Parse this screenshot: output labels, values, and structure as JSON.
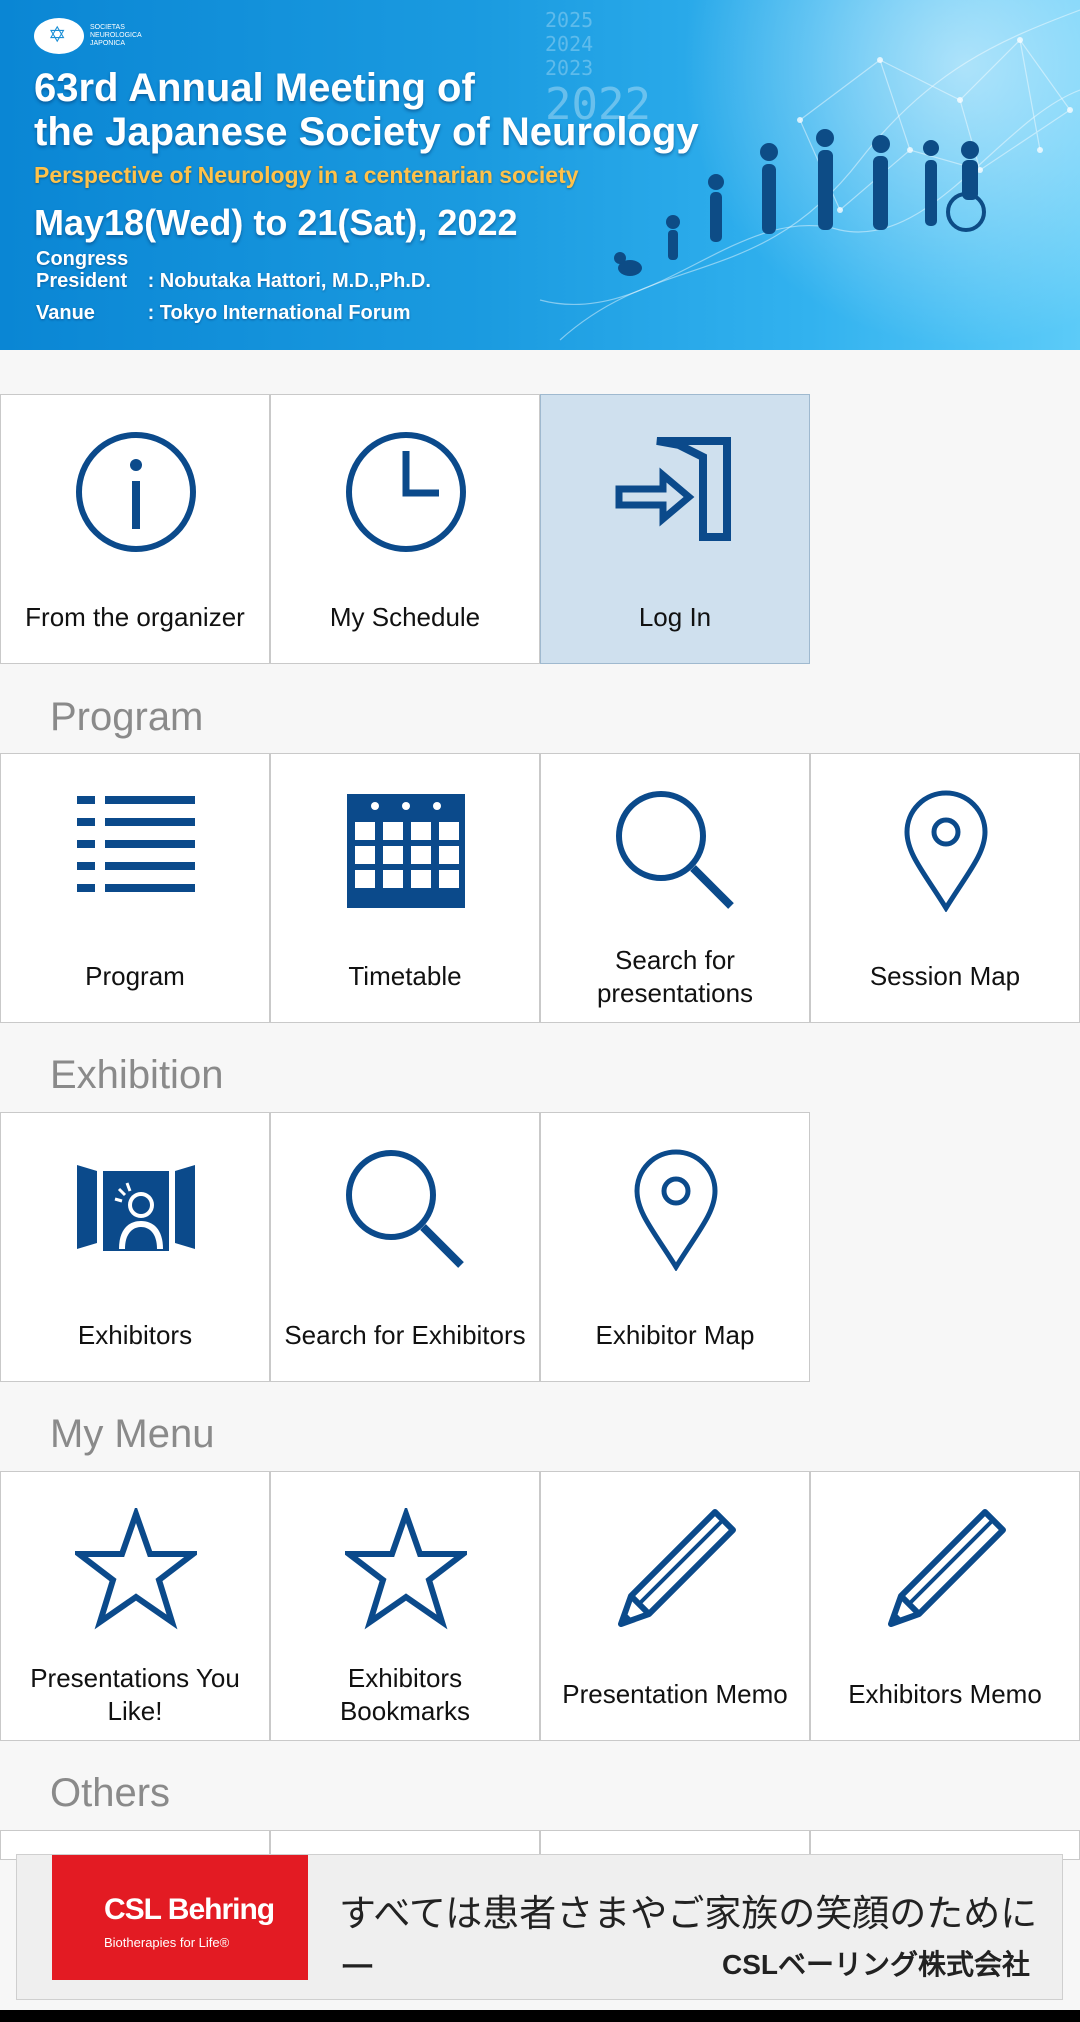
{
  "banner": {
    "logo_text": "SOCIETAS NEUROLOGICA JAPONICA",
    "years": [
      "2025",
      "2024",
      "2023",
      "2022"
    ],
    "title_line1": "63rd Annual Meeting of",
    "title_line2": "the Japanese Society of Neurology",
    "subtitle": "Perspective of Neurology in a centenarian society",
    "dates": "May18(Wed) to 21(Sat), 2022",
    "president_key": "Congress President",
    "president_value": ": Nobutaka Hattori, M.D.,Ph.D.",
    "venue_key": "Vanue",
    "venue_value": ": Tokyo International Forum"
  },
  "top_tiles": [
    {
      "label": "From the organizer",
      "icon": "info-icon"
    },
    {
      "label": "My Schedule",
      "icon": "clock-icon"
    },
    {
      "label": "Log In",
      "icon": "login-icon",
      "active": true
    }
  ],
  "sections": {
    "program": {
      "heading": "Program",
      "tiles": [
        {
          "label": "Program",
          "icon": "list-icon"
        },
        {
          "label": "Timetable",
          "icon": "calendar-icon"
        },
        {
          "label": "Search for presentations",
          "icon": "search-icon"
        },
        {
          "label": "Session Map",
          "icon": "map-pin-icon"
        }
      ]
    },
    "exhibition": {
      "heading": "Exhibition",
      "tiles": [
        {
          "label": "Exhibitors",
          "icon": "exhibitor-booth-icon"
        },
        {
          "label": "Search for Exhibitors",
          "icon": "search-icon"
        },
        {
          "label": "Exhibitor Map",
          "icon": "map-pin-icon"
        }
      ]
    },
    "my_menu": {
      "heading": "My Menu",
      "tiles": [
        {
          "label": "Presentations You Like!",
          "icon": "star-icon"
        },
        {
          "label": "Exhibitors Bookmarks",
          "icon": "star-icon"
        },
        {
          "label": "Presentation Memo",
          "icon": "pencil-icon"
        },
        {
          "label": "Exhibitors Memo",
          "icon": "pencil-icon"
        }
      ]
    },
    "others": {
      "heading": "Others"
    }
  },
  "ad": {
    "brand": "CSL Behring",
    "tagline": "Biotherapies for Life®",
    "jp_message": "すべては患者さまやご家族の笑顔のためにー",
    "company": "CSLベーリング株式会社"
  },
  "colors": {
    "icon_blue": "#0b4a8b",
    "active_tile": "#cfe0ee",
    "section_heading": "#8a8a8a",
    "ad_red": "#e31b23",
    "subtitle_gold": "#ffc24a"
  }
}
